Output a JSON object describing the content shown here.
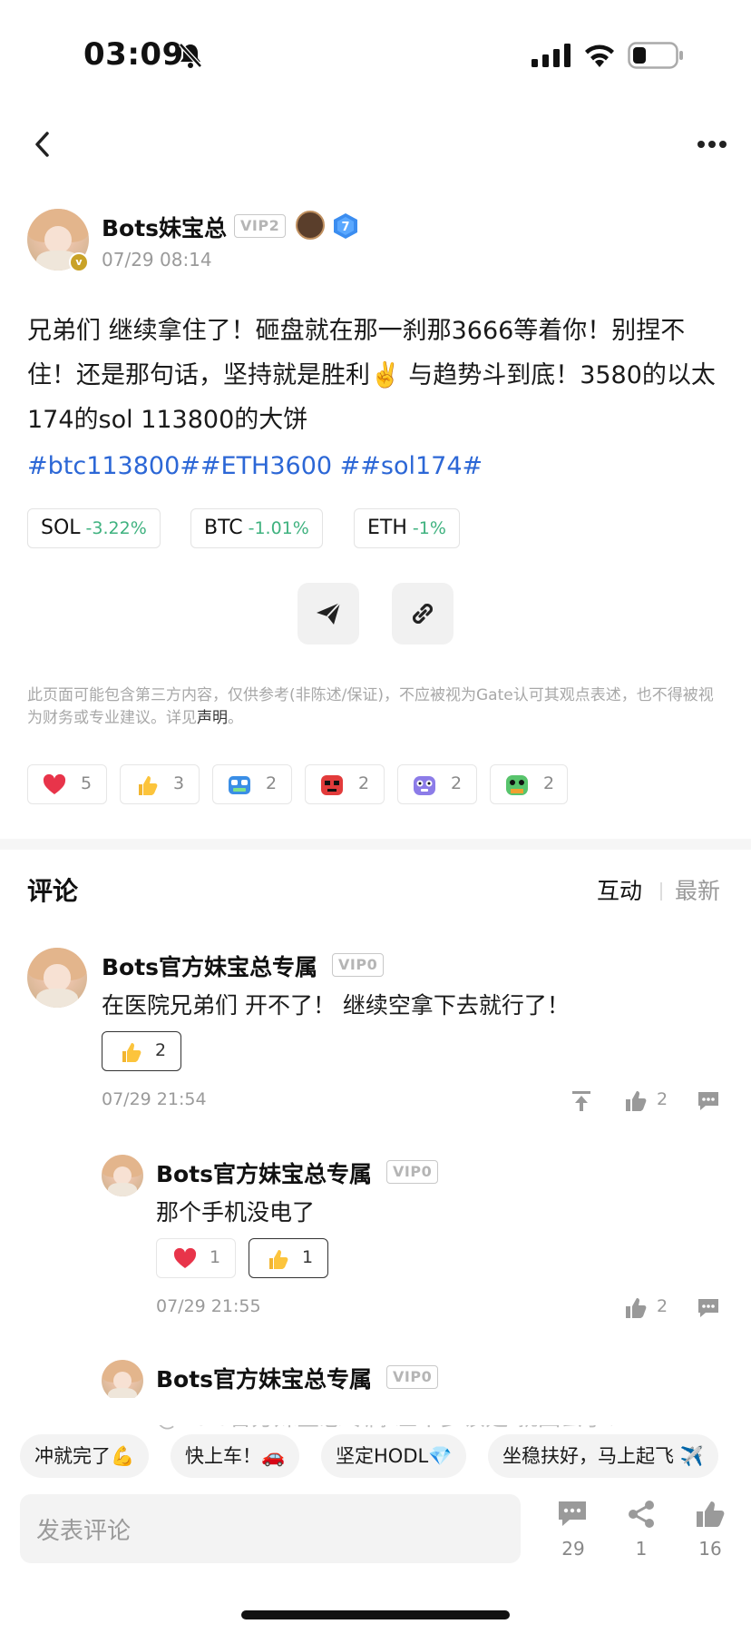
{
  "status_bar": {
    "time": "03:09"
  },
  "post": {
    "author": "Bots妹宝总",
    "vip": "VIP2",
    "level": "7",
    "time": "07/29 08:14",
    "text": "兄弟们 继续拿住了！砸盘就在那一刹那3666等着你！别捏不住！还是那句话，坚持就是胜利✌️ 与趋势斗到底！3580的以太 174的sol 113800的大饼",
    "tags": "#btc113800##ETH3600 ##sol174#",
    "coins": [
      {
        "symbol": "SOL",
        "change": "-3.22%"
      },
      {
        "symbol": "BTC",
        "change": "-1.01%"
      },
      {
        "symbol": "ETH",
        "change": "-1%"
      }
    ],
    "disclaimer": "此页面可能包含第三方内容，仅供参考(非陈述/保证)，不应被视为Gate认可其观点表述，也不得被视为财务或专业建议。详见",
    "disclaimer_link": "声明",
    "reactions": [
      {
        "emoji": "heart-icon",
        "count": "5"
      },
      {
        "emoji": "thumbs-up-icon",
        "count": "3"
      },
      {
        "emoji": "robot-emoji-icon",
        "count": "2"
      },
      {
        "emoji": "angry-red-emoji-icon",
        "count": "2"
      },
      {
        "emoji": "purple-monster-emoji-icon",
        "count": "2"
      },
      {
        "emoji": "sick-green-emoji-icon",
        "count": "2"
      }
    ]
  },
  "comments_section": {
    "title": "评论",
    "sort_hot": "互动",
    "sort_new": "最新",
    "comments": [
      {
        "author": "Bots官方妹宝总专属",
        "vip": "VIP0",
        "text": "在医院兄弟们 开不了！ 继续空拿下去就行了！",
        "reaction_count": "2",
        "time": "07/29 21:54",
        "likes": "2"
      },
      {
        "author": "Bots官方妹宝总专属",
        "vip": "VIP0",
        "text": "那个手机没电了",
        "heart_count": "1",
        "thumb_count": "1",
        "time": "07/29 21:55",
        "likes": "2"
      },
      {
        "author": "Bots官方妹宝总专属",
        "vip": "VIP0",
        "text": "@Bots官方妹宝总专属 差不多该是 就回去了！"
      }
    ]
  },
  "quick_replies": [
    "冲就完了💪",
    "快上车！🚗",
    "坚定HODL💎",
    "坐稳扶好，马上起飞 ✈️"
  ],
  "bottom_bar": {
    "placeholder": "发表评论",
    "comments": "29",
    "shares": "1",
    "likes": "16"
  }
}
